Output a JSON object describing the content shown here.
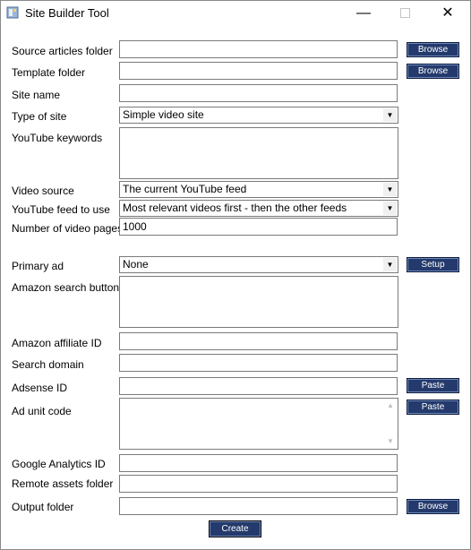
{
  "window": {
    "title": "Site Builder Tool"
  },
  "labels": {
    "source_articles_folder": "Source articles folder",
    "template_folder": "Template folder",
    "site_name": "Site name",
    "type_of_site": "Type of site",
    "youtube_keywords": "YouTube keywords",
    "video_source": "Video source",
    "youtube_feed": "YouTube feed to use",
    "video_pages": "Number of video pages",
    "primary_ad": "Primary ad",
    "amazon_search_buttons": "Amazon search buttons",
    "amazon_affiliate_id": "Amazon affiliate ID",
    "search_domain": "Search domain",
    "adsense_id": "Adsense ID",
    "ad_unit_code": "Ad unit code",
    "google_analytics_id": "Google Analytics ID",
    "remote_assets_folder": "Remote assets folder",
    "output_folder": "Output folder"
  },
  "values": {
    "type_of_site": "Simple video site",
    "video_source": "The current YouTube feed",
    "youtube_feed": "Most relevant videos first - then the other feeds",
    "video_pages": "1000",
    "primary_ad": "None"
  },
  "buttons": {
    "browse": "Browse",
    "setup": "Setup",
    "paste": "Paste",
    "create": "Create"
  },
  "colors": {
    "button_bg": "#243a6c",
    "button_text": "#ffffff"
  }
}
